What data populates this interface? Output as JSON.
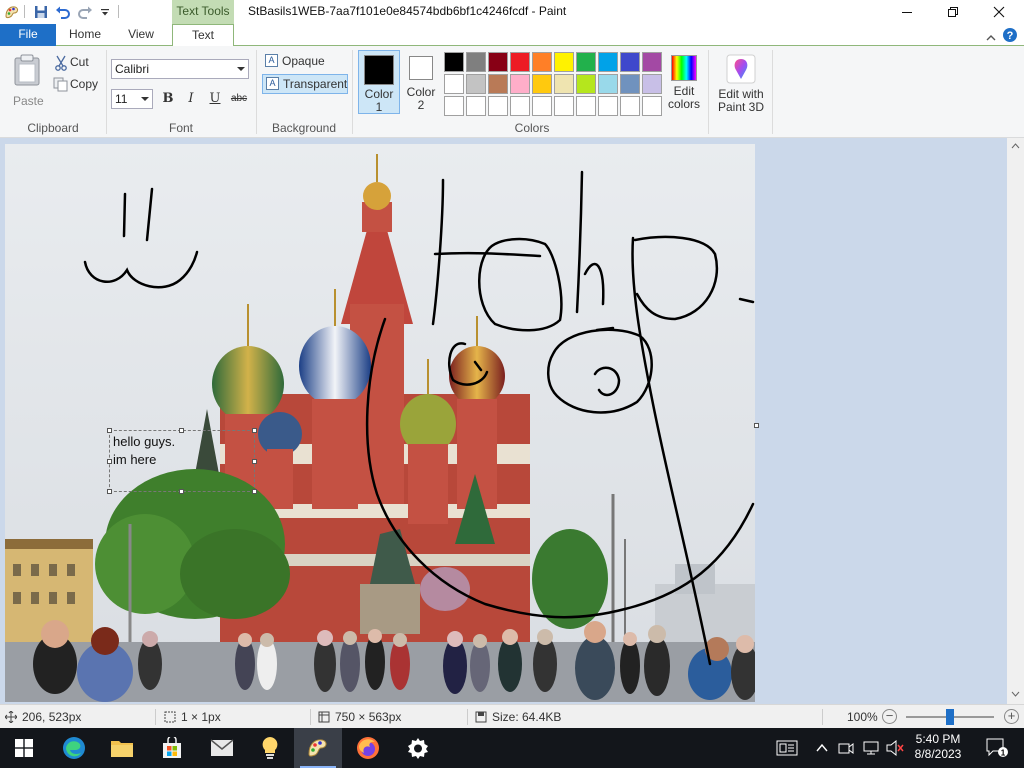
{
  "window": {
    "context_tab": "Text Tools",
    "title": "StBasils1WEB-7aa7f101e0e84574bdb6bf1c4246fcdf - Paint"
  },
  "tabs": {
    "file": "File",
    "home": "Home",
    "view": "View",
    "text": "Text"
  },
  "clipboard": {
    "paste": "Paste",
    "cut": "Cut",
    "copy": "Copy",
    "label": "Clipboard"
  },
  "font": {
    "family": "Calibri",
    "size": "11",
    "bold": "B",
    "italic": "I",
    "underline": "U",
    "strike": "abc",
    "label": "Font"
  },
  "background": {
    "opaque": "Opaque",
    "transparent": "Transparent",
    "label": "Background"
  },
  "colors": {
    "color1": "Color 1",
    "color2": "Color 2",
    "edit_colors": "Edit colors",
    "edit_3d": "Edit with Paint 3D",
    "label": "Colors",
    "color1_value": "#000000",
    "color2_value": "#ffffff",
    "palette_row1": [
      "#000000",
      "#7f7f7f",
      "#880015",
      "#ed1c24",
      "#ff7f27",
      "#fff200",
      "#22b14c",
      "#00a2e8",
      "#3f48cc",
      "#a349a4"
    ],
    "palette_row2": [
      "#ffffff",
      "#c3c3c3",
      "#b97a57",
      "#ffaec9",
      "#ffc90e",
      "#efe4b0",
      "#b5e61d",
      "#99d9ea",
      "#7092be",
      "#c8bfe7"
    ],
    "palette_row3": [
      "#ffffff",
      "#ffffff",
      "#ffffff",
      "#ffffff",
      "#ffffff",
      "#ffffff",
      "#ffffff",
      "#ffffff",
      "#ffffff",
      "#ffffff"
    ]
  },
  "canvas": {
    "text_box": "hello guys.\nim here"
  },
  "status": {
    "cursor_pos": "206, 523px",
    "selection_size": "1 × 1px",
    "image_size": "750 × 563px",
    "file_size": "Size: 64.4KB",
    "zoom": "100%",
    "zoom_level": 0.5
  },
  "taskbar": {
    "time": "5:40 PM",
    "date": "8/8/2023"
  }
}
